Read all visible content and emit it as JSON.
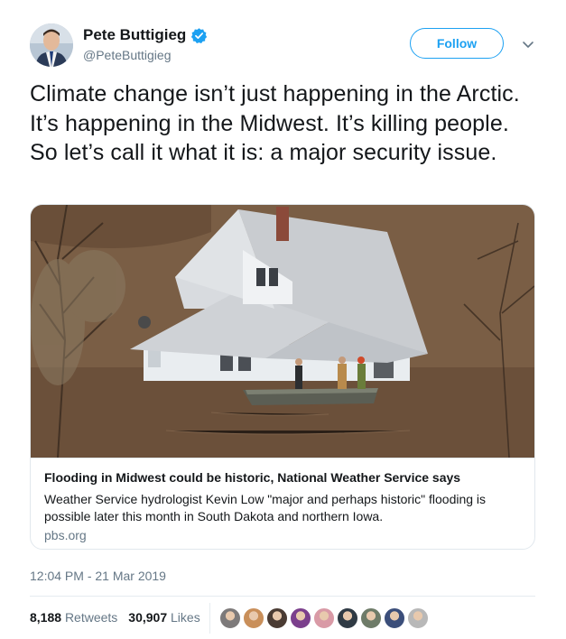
{
  "author": {
    "name": "Pete Buttigieg",
    "handle": "@PeteButtigieg",
    "verified": true
  },
  "follow_label": "Follow",
  "tweet_text": "Climate change isn’t just happening in the Arctic. It’s happening in the Midwest. It’s killing people. So let’s call it what it is: a major security issue.",
  "card": {
    "title": "Flooding in Midwest could be historic, National Weather Service says",
    "description": "Weather Service hydrologist Kevin Low \"major and perhaps historic\" flooding is possible later this month in South Dakota and northern Iowa.",
    "domain": "pbs.org"
  },
  "timestamp": "12:04 PM - 21 Mar 2019",
  "stats": {
    "retweets_count": "8,188",
    "retweets_label": "Retweets",
    "likes_count": "30,907",
    "likes_label": "Likes"
  },
  "likers": [
    {
      "color": "#7d7a7a"
    },
    {
      "color": "#c98f5a"
    },
    {
      "color": "#4a3b33"
    },
    {
      "color": "#7b3f8c"
    },
    {
      "color": "#d99aa6"
    },
    {
      "color": "#2f3a44"
    },
    {
      "color": "#6e7b68"
    },
    {
      "color": "#3b4e7a"
    },
    {
      "color": "#b8b8b8"
    }
  ],
  "colors": {
    "accent": "#1da1f2",
    "muted": "#657786",
    "text": "#14171a"
  }
}
